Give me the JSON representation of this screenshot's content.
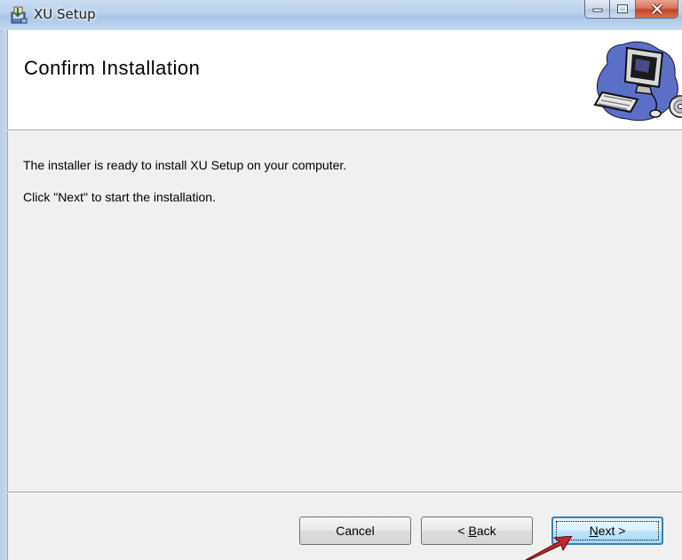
{
  "window": {
    "title": "XU Setup",
    "icon": "installer-icon",
    "controls": [
      "minimize-icon",
      "maximize-icon",
      "close-icon"
    ]
  },
  "banner": {
    "title": "Confirm Installation",
    "art": "computer-setup-illustration"
  },
  "body": {
    "line1": "The installer is ready to install XU Setup on your computer.",
    "line2": "Click \"Next\" to start the installation."
  },
  "buttons": {
    "cancel": "Cancel",
    "back_prefix": "< ",
    "back_accel": "B",
    "back_rest": "ack",
    "next_accel": "N",
    "next_rest": "ext >"
  },
  "colors": {
    "titlebar": "#b8d0ec",
    "close_button": "#c2432a",
    "default_button_border": "#3c7fb1",
    "annotation_arrow": "#c0282e"
  }
}
